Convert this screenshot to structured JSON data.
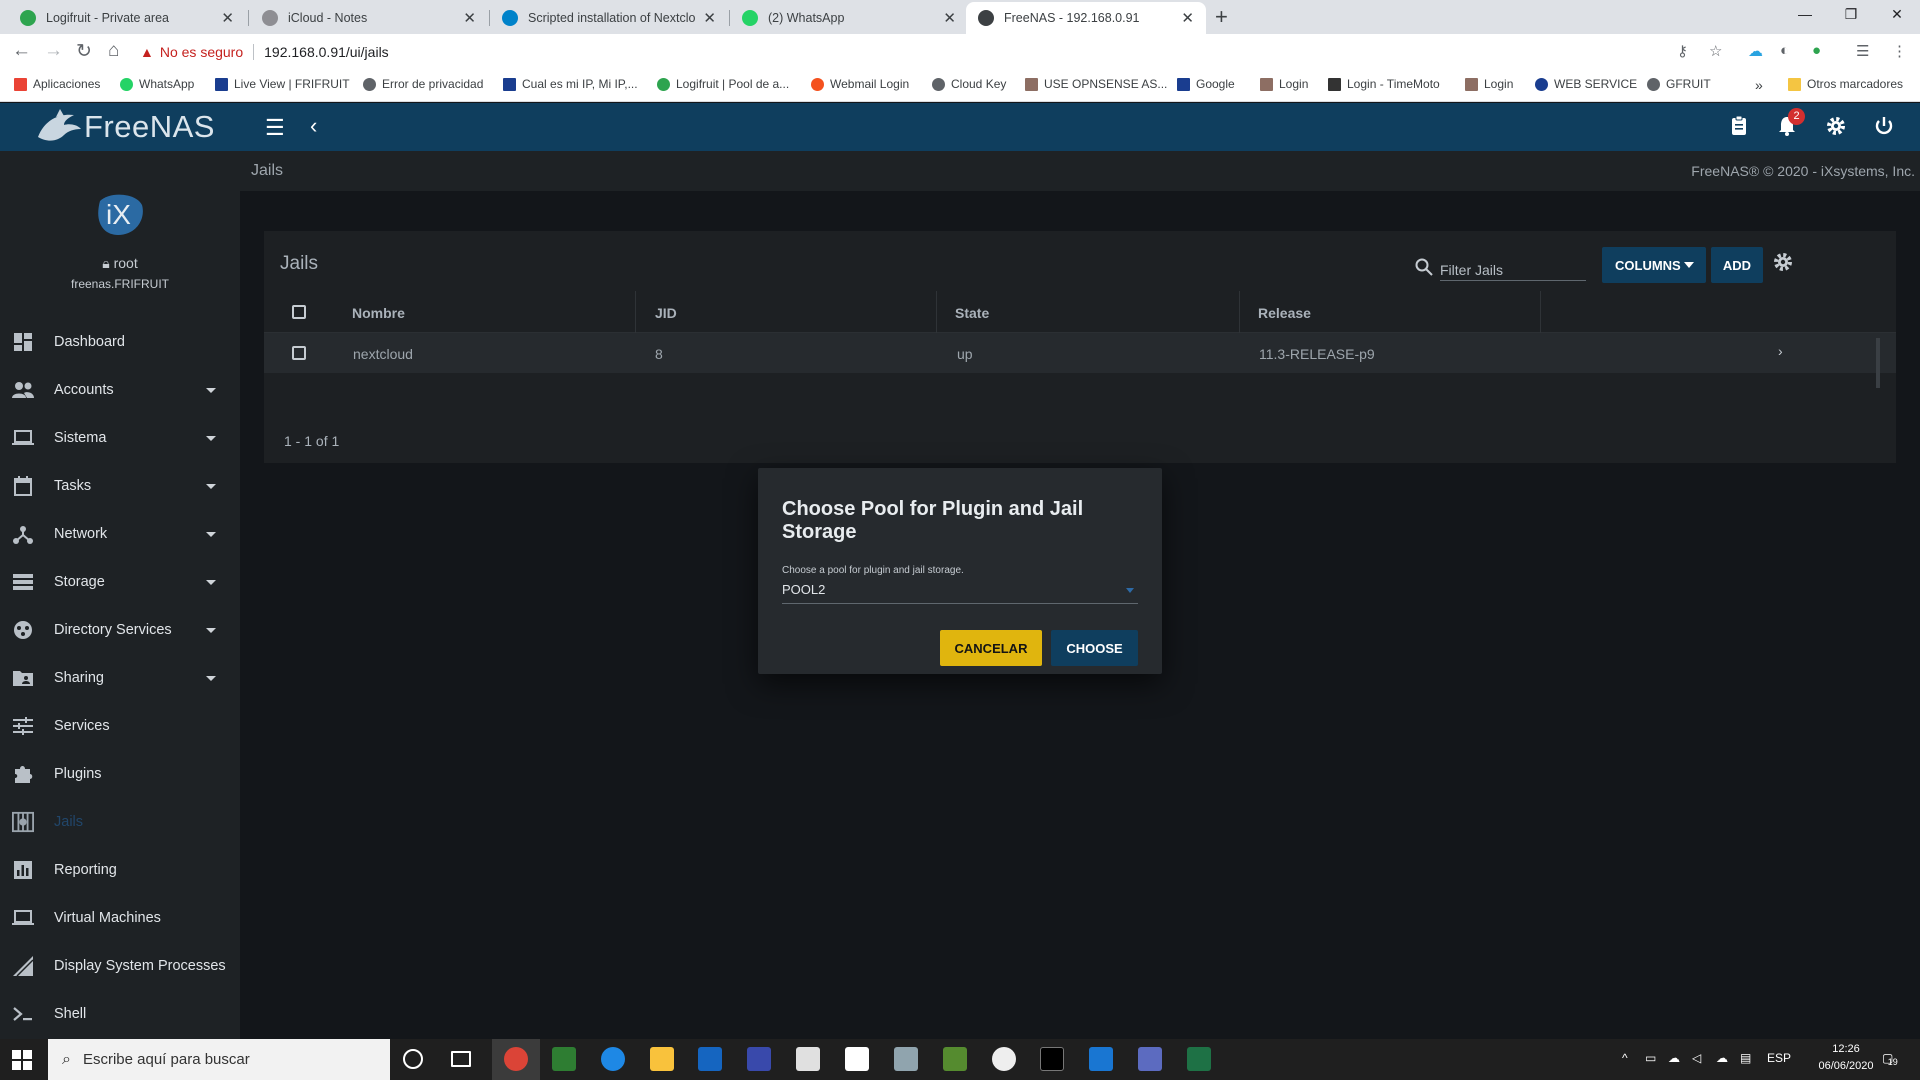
{
  "browser": {
    "tabs": [
      {
        "title": "Logifruit - Private area",
        "color": "#2ea44f"
      },
      {
        "title": "iCloud - Notes",
        "color": "#8e8e93"
      },
      {
        "title": "Scripted installation of Nextcloud",
        "color": "#0082c9"
      },
      {
        "title": "(2) WhatsApp",
        "color": "#25d366"
      },
      {
        "title": "FreeNAS - 192.168.0.91",
        "color": "#3c4043"
      }
    ],
    "insecure_label": "No es seguro",
    "url": "192.168.0.91/ui/jails",
    "bookmarks": [
      {
        "label": "Aplicaciones",
        "color": "#ea4335"
      },
      {
        "label": "WhatsApp",
        "color": "#25d366"
      },
      {
        "label": "Live View | FRIFRUIT",
        "color": "#1a3d8f"
      },
      {
        "label": "Error de privacidad",
        "color": "#5f6368"
      },
      {
        "label": "Cual es mi IP, Mi IP,...",
        "color": "#1a3d8f"
      },
      {
        "label": "Logifruit | Pool de a...",
        "color": "#2ea44f"
      },
      {
        "label": "Webmail Login",
        "color": "#f4511e"
      },
      {
        "label": "Cloud Key",
        "color": "#5f6368"
      },
      {
        "label": "USE OPNSENSE AS...",
        "color": "#8d6e63"
      },
      {
        "label": "Google",
        "color": "#1a3d8f"
      },
      {
        "label": "Login",
        "color": "#8d6e63"
      },
      {
        "label": "Login - TimeMoto",
        "color": "#333333"
      },
      {
        "label": "Login",
        "color": "#8d6e63"
      },
      {
        "label": "WEB SERVICE",
        "color": "#1a3d8f"
      },
      {
        "label": "GFRUIT",
        "color": "#5f6368"
      }
    ],
    "other_bookmarks": "Otros marcadores"
  },
  "app": {
    "brand": "FreeNAS",
    "notifications_count": "2",
    "user": "root",
    "hostname": "freenas.FRIFRUIT",
    "menu": [
      {
        "label": "Dashboard",
        "icon": "dashboard-icon"
      },
      {
        "label": "Accounts",
        "icon": "people-icon"
      },
      {
        "label": "Sistema",
        "icon": "laptop-icon"
      },
      {
        "label": "Tasks",
        "icon": "calendar-icon"
      },
      {
        "label": "Network",
        "icon": "network-icon"
      },
      {
        "label": "Storage",
        "icon": "storage-icon"
      },
      {
        "label": "Directory Services",
        "icon": "directory-icon"
      },
      {
        "label": "Sharing",
        "icon": "folder-shared-icon"
      },
      {
        "label": "Services",
        "icon": "tune-icon"
      },
      {
        "label": "Plugins",
        "icon": "puzzle-icon"
      },
      {
        "label": "Jails",
        "icon": "jail-icon"
      },
      {
        "label": "Reporting",
        "icon": "chart-icon"
      },
      {
        "label": "Virtual Machines",
        "icon": "computer-icon"
      },
      {
        "label": "Display System Processes",
        "icon": "processes-icon"
      },
      {
        "label": "Shell",
        "icon": "shell-icon"
      }
    ],
    "breadcrumb": "Jails",
    "copyright": "FreeNAS® © 2020 - iXsystems, Inc."
  },
  "jails_card": {
    "title": "Jails",
    "filter_placeholder": "Filter Jails",
    "columns_label": "COLUMNS",
    "add_label": "ADD",
    "headers": [
      "Nombre",
      "JID",
      "State",
      "Release"
    ],
    "rows": [
      {
        "name": "nextcloud",
        "jid": "8",
        "state": "up",
        "release": "11.3-RELEASE-p9"
      }
    ],
    "pager": "1 - 1 of 1"
  },
  "dialog": {
    "title": "Choose Pool for Plugin and Jail Storage",
    "field_label": "Choose a pool for plugin and jail storage.",
    "selected_pool": "POOL2",
    "cancel_label": "CANCELAR",
    "choose_label": "CHOOSE"
  },
  "taskbar": {
    "search_placeholder": "Escribe aquí para buscar",
    "language": "ESP",
    "time": "12:26",
    "date": "06/06/2020",
    "notification_count": "19"
  }
}
